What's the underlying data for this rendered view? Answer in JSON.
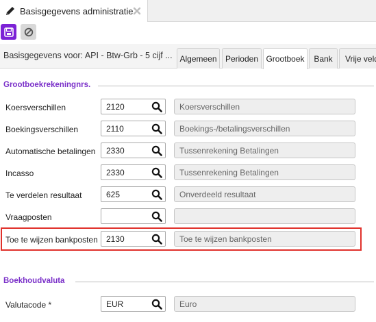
{
  "window": {
    "tab_title": "Basisgegevens administratie"
  },
  "toolbar": {
    "save_icon": "floppy-disk-icon",
    "cancel_icon": "ban-icon"
  },
  "subheader": {
    "heading": "Basisgegevens voor: API - Btw-Grb - 5 cijf ...",
    "tabs": [
      "Algemeen",
      "Perioden",
      "Grootboek",
      "Bank",
      "Vrije velde"
    ],
    "active_tab": "Grootboek"
  },
  "section_grootboek": {
    "title": "Grootboekrekeningnrs.",
    "rows": [
      {
        "label": "Koersverschillen",
        "code": "2120",
        "description": "Koersverschillen"
      },
      {
        "label": "Boekingsverschillen",
        "code": "2110",
        "description": "Boekings-/betalingsverschillen"
      },
      {
        "label": "Automatische betalingen",
        "code": "2330",
        "description": "Tussenrekening Betalingen"
      },
      {
        "label": "Incasso",
        "code": "2330",
        "description": "Tussenrekening Betalingen"
      },
      {
        "label": "Te verdelen resultaat",
        "code": "625",
        "description": "Onverdeeld resultaat"
      },
      {
        "label": "Vraagposten",
        "code": "",
        "description": ""
      },
      {
        "label": "Toe te wijzen bankposten",
        "code": "2130",
        "description": "Toe te wijzen bankposten"
      }
    ]
  },
  "section_valuta": {
    "title": "Boekhoudvaluta",
    "rows": [
      {
        "label": "Valutacode *",
        "code": "EUR",
        "description": "Euro"
      }
    ]
  },
  "colors": {
    "accent": "#7c22d6",
    "section_title": "#7b31c9",
    "highlight": "#e0302a"
  }
}
